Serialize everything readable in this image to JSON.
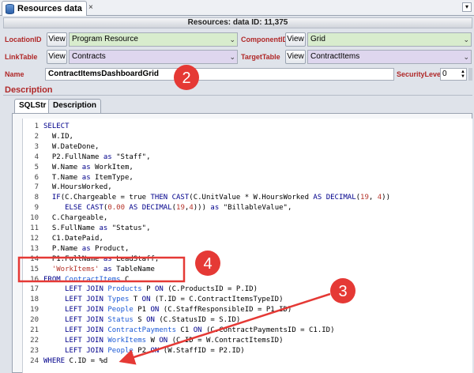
{
  "tab": {
    "title": "Resources data",
    "close": "×",
    "menu": "▾"
  },
  "caption": "Resources: data ID: 11,375",
  "fields": {
    "location_id": {
      "label": "LocationID",
      "view": "View",
      "value": "Program Resource"
    },
    "component_id": {
      "label": "ComponentID",
      "view": "View",
      "value": "Grid"
    },
    "link_table": {
      "label": "LinkTable",
      "view": "View",
      "value": "Contracts"
    },
    "target_table": {
      "label": "TargetTable",
      "view": "View",
      "value": "ContractItems"
    },
    "name": {
      "label": "Name",
      "value": "ContractItemsDashboardGrid"
    },
    "security_level": {
      "label": "SecurityLevel",
      "value": "0"
    }
  },
  "description_label": "Description",
  "inner_tabs": [
    "SQLStr",
    "Description"
  ],
  "code_lines": [
    {
      "n": "1",
      "text": "SELECT"
    },
    {
      "n": "2",
      "text": "  W.ID,"
    },
    {
      "n": "3",
      "text": "  W.DateDone,"
    },
    {
      "n": "4",
      "text": "  P2.FullName as \"Staff\","
    },
    {
      "n": "5",
      "text": "  W.Name as WorkItem,"
    },
    {
      "n": "6",
      "text": "  T.Name as ItemType,"
    },
    {
      "n": "7",
      "text": "  W.HoursWorked,"
    },
    {
      "n": "8",
      "text": "  IF(C.Chargeable = true THEN CAST(C.UnitValue * W.HoursWorked AS DECIMAL(19, 4))"
    },
    {
      "n": "9",
      "text": "     ELSE CAST(0.00 AS DECIMAL(19,4))) as \"BillableValue\","
    },
    {
      "n": "10",
      "text": "  C.Chargeable,"
    },
    {
      "n": "11",
      "text": "  S.FullName as \"Status\","
    },
    {
      "n": "12",
      "text": "  C1.DatePaid,"
    },
    {
      "n": "13",
      "text": "  P.Name as Product,"
    },
    {
      "n": "14",
      "text": "  P1.FullName as LeadStaff,"
    },
    {
      "n": "15",
      "text": "  'WorkItems' as TableName"
    },
    {
      "n": "16",
      "text": "FROM ContractItems C"
    },
    {
      "n": "17",
      "text": "     LEFT JOIN Products P ON (C.ProductsID = P.ID)"
    },
    {
      "n": "18",
      "text": "     LEFT JOIN Types T ON (T.ID = C.ContractItemsTypeID)"
    },
    {
      "n": "19",
      "text": "     LEFT JOIN People P1 ON (C.StaffResponsibleID = P1.ID)"
    },
    {
      "n": "20",
      "text": "     LEFT JOIN Status S ON (C.StatusID = S.ID)"
    },
    {
      "n": "21",
      "text": "     LEFT JOIN ContractPayments C1 ON (C.ContractPaymentsID = C1.ID)"
    },
    {
      "n": "22",
      "text": "     LEFT JOIN WorkItems W ON (C.ID = W.ContractItemsID)"
    },
    {
      "n": "23",
      "text": "     LEFT JOIN People P2 ON (W.StaffID = P2.ID)"
    },
    {
      "n": "24",
      "text": "WHERE C.ID = %d"
    }
  ],
  "annotations": {
    "badge_2": "2",
    "badge_3": "3",
    "badge_4": "4",
    "color": "#e53935"
  }
}
